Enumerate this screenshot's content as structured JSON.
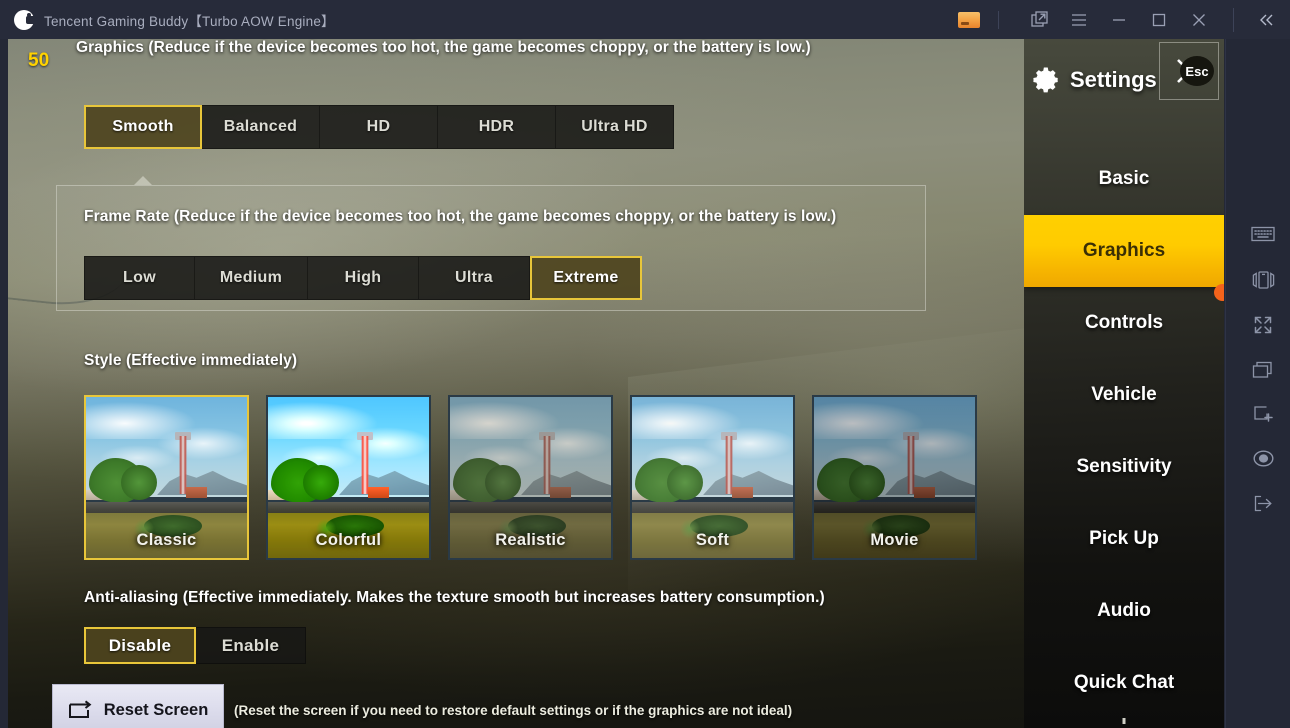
{
  "window": {
    "title": "Tencent Gaming Buddy【Turbo AOW Engine】",
    "logo_icon": "tencent-gaming-buddy-logo",
    "controls": {
      "card_icon": "payment-card-icon",
      "popout_label": "popout-icon",
      "menu_label": "hamburger-menu-icon",
      "minimize_label": "minimize-icon",
      "maximize_label": "maximize-icon",
      "close_label": "close-icon",
      "collapse_label": "collapse-chevrons-icon"
    }
  },
  "toolbar": {
    "items": [
      {
        "icon": "keyboard-icon",
        "name": "keyboard-mapping"
      },
      {
        "icon": "phone-rotate-icon",
        "name": "rotate-screen"
      },
      {
        "icon": "fullscreen-icon",
        "name": "fullscreen"
      },
      {
        "icon": "multi-window-icon",
        "name": "multi-instance"
      },
      {
        "icon": "add-window-icon",
        "name": "new-window"
      },
      {
        "icon": "record-icon",
        "name": "screen-record"
      },
      {
        "icon": "exit-icon",
        "name": "exit"
      }
    ]
  },
  "hud": {
    "fps": "50"
  },
  "settings": {
    "panel_title": "Settings",
    "gear_icon": "gear-icon",
    "esc_label": "Esc",
    "close_icon": "close-x-icon",
    "nav": [
      {
        "label": "Basic",
        "active": false,
        "badge": false
      },
      {
        "label": "Graphics",
        "active": true,
        "badge": true
      },
      {
        "label": "Controls",
        "active": false,
        "badge": false
      },
      {
        "label": "Vehicle",
        "active": false,
        "badge": false
      },
      {
        "label": "Sensitivity",
        "active": false,
        "badge": false
      },
      {
        "label": "Pick Up",
        "active": false,
        "badge": false
      },
      {
        "label": "Audio",
        "active": false,
        "badge": false
      },
      {
        "label": "Quick Chat",
        "active": false,
        "badge": false
      }
    ],
    "accent_yellow": "#ffcb00",
    "badge_orange": "#f4631b",
    "selected_border": "#e8c63a"
  },
  "graphics": {
    "quality": {
      "title": "Graphics (Reduce if the device becomes too hot, the game becomes choppy, or the battery is low.)",
      "options": [
        "Smooth",
        "Balanced",
        "HD",
        "HDR",
        "Ultra HD"
      ],
      "selected": "Smooth"
    },
    "frame_rate": {
      "title": "Frame Rate (Reduce if the device becomes too hot, the game becomes choppy, or the battery is low.)",
      "options": [
        "Low",
        "Medium",
        "High",
        "Ultra",
        "Extreme"
      ],
      "selected": "Extreme"
    },
    "style": {
      "title": "Style (Effective immediately)",
      "options": [
        "Classic",
        "Colorful",
        "Realistic",
        "Soft",
        "Movie"
      ],
      "selected": "Classic"
    },
    "anti_aliasing": {
      "title": "Anti-aliasing (Effective immediately. Makes the texture smooth but increases battery consumption.)",
      "options": [
        "Disable",
        "Enable"
      ],
      "selected": "Disable"
    },
    "reset": {
      "button_label": "Reset Screen",
      "icon": "reset-screen-icon",
      "note": "(Reset the screen if you need to restore default settings or if the graphics are not ideal)"
    }
  }
}
